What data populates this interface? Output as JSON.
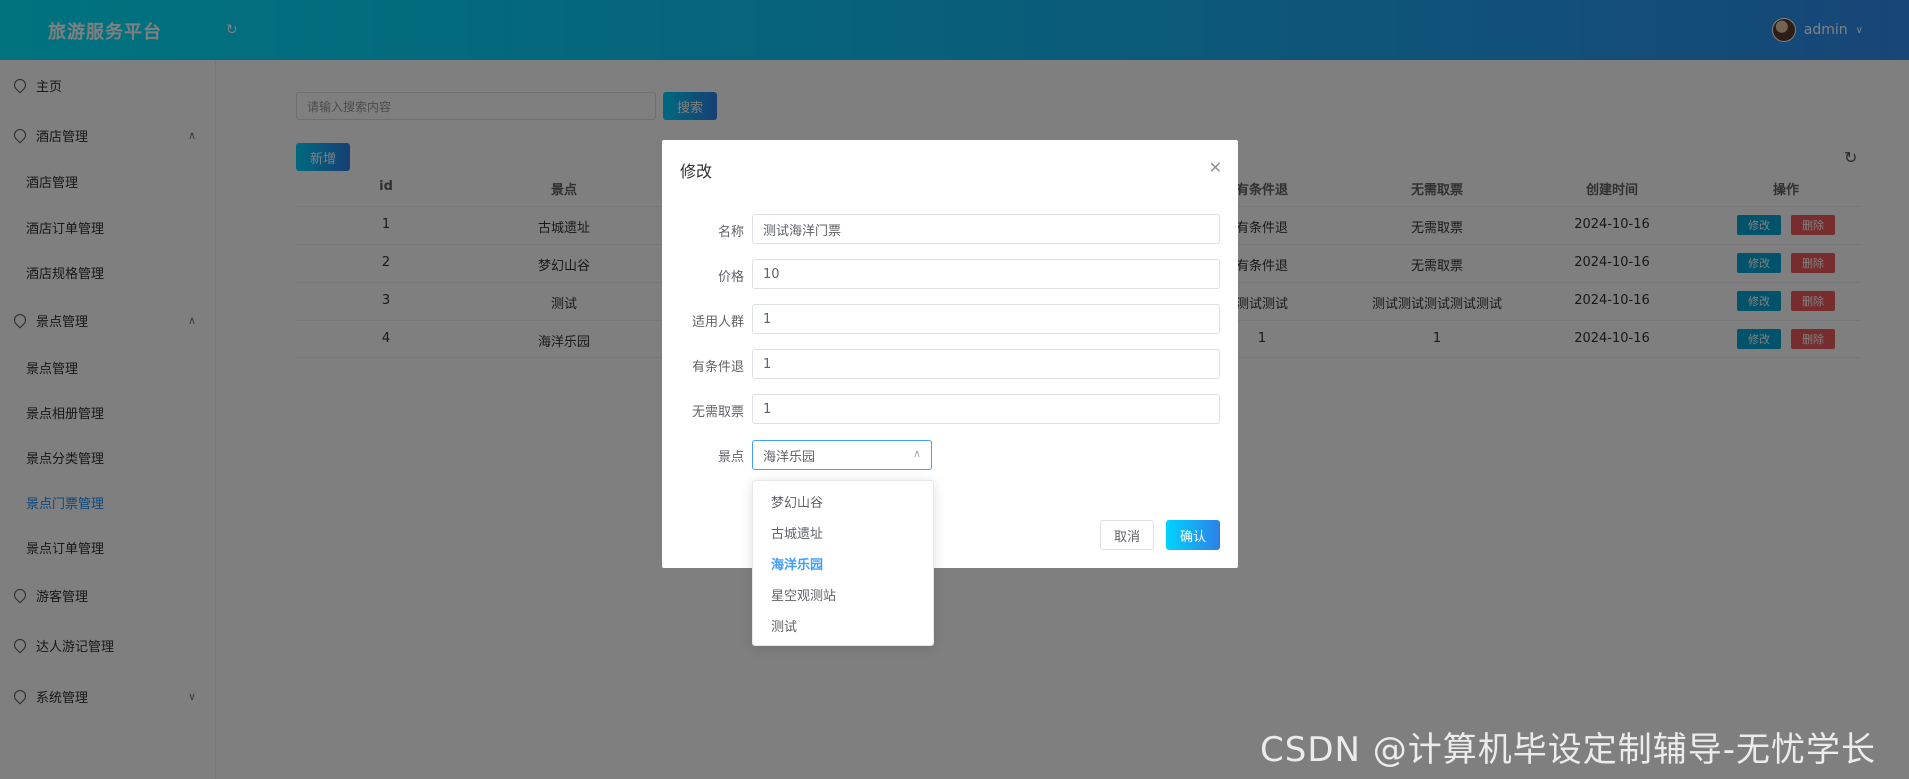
{
  "header": {
    "title": "旅游服务平台",
    "refresh_icon": "refresh-icon",
    "user_name": "admin",
    "user_chevron": "chevron-down-icon"
  },
  "sidebar": {
    "items": [
      {
        "label": "主页",
        "icon": "location-icon"
      },
      {
        "label": "酒店管理",
        "icon": "location-icon",
        "expanded": true
      },
      {
        "label": "酒店管理"
      },
      {
        "label": "酒店订单管理"
      },
      {
        "label": "酒店规格管理"
      },
      {
        "label": "景点管理",
        "icon": "location-icon",
        "expanded": true
      },
      {
        "label": "景点管理"
      },
      {
        "label": "景点相册管理"
      },
      {
        "label": "景点分类管理"
      },
      {
        "label": "景点门票管理",
        "active": true
      },
      {
        "label": "景点订单管理"
      },
      {
        "label": "游客管理",
        "icon": "location-icon"
      },
      {
        "label": "达人游记管理",
        "icon": "location-icon"
      },
      {
        "label": "系统管理",
        "icon": "location-icon",
        "expanded": false
      }
    ]
  },
  "toolbar": {
    "search_placeholder": "请输入搜索内容",
    "search_label": "搜索",
    "add_label": "新增"
  },
  "table": {
    "headers": [
      "id",
      "景点",
      "有条件退",
      "无需取票",
      "创建时间",
      "操作"
    ],
    "rows": [
      {
        "id": "1",
        "spot": "古城遗址",
        "refund": "有条件退",
        "ticket": "无需取票",
        "created": "2024-10-16"
      },
      {
        "id": "2",
        "spot": "梦幻山谷",
        "refund": "有条件退",
        "ticket": "无需取票",
        "created": "2024-10-16"
      },
      {
        "id": "3",
        "spot": "测试",
        "refund": "测试测试",
        "ticket": "测试测试测试测试测试",
        "created": "2024-10-16"
      },
      {
        "id": "4",
        "spot": "海洋乐园",
        "refund": "1",
        "ticket": "1",
        "created": "2024-10-16"
      }
    ],
    "edit_label": "修改",
    "delete_label": "删除"
  },
  "dialog": {
    "title": "修改",
    "fields": [
      {
        "label": "名称",
        "value": "测试海洋门票"
      },
      {
        "label": "价格",
        "value": "10"
      },
      {
        "label": "适用人群",
        "value": "1"
      },
      {
        "label": "有条件退",
        "value": "1"
      },
      {
        "label": "无需取票",
        "value": "1"
      }
    ],
    "select_label": "景点",
    "select_value": "海洋乐园",
    "cancel_label": "取消",
    "confirm_label": "确认"
  },
  "dropdown": {
    "options": [
      "梦幻山谷",
      "古城遗址",
      "海洋乐园",
      "星空观测站",
      "测试"
    ],
    "selected_index": 2
  },
  "watermark": "CSDN @计算机毕设定制辅导-无忧学长",
  "colors": {
    "header_start": "#00e7ff",
    "header_end": "#2e8cf0",
    "active": "#1890ff",
    "delete": "#ef5b5b"
  }
}
